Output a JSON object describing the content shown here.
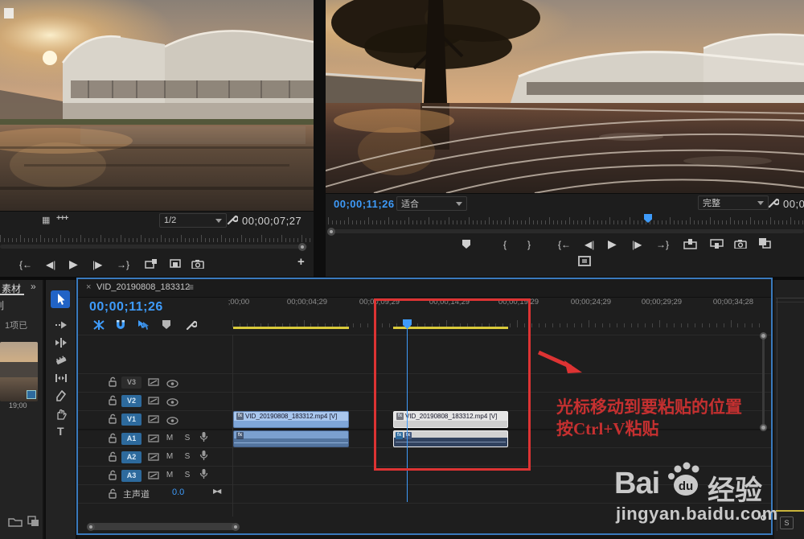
{
  "icons": {
    "close": "×",
    "menu": "≡",
    "chevron_right": "»",
    "play": "▶",
    "step_back": "◀|",
    "step_fwd": "|▶",
    "goto_in": "{←",
    "goto_out": "→}",
    "mark_in": "{",
    "mark_out": "}",
    "plus": "+",
    "safe_margins": "▦",
    "button_editor": "+++",
    "bowtie": "▶◀",
    "type_tool": "T"
  },
  "source_monitor": {
    "zoom_value": "1/2",
    "duration": "00;00;07;27"
  },
  "program_monitor": {
    "current_time": "00;00;11;26",
    "fit_value": "适合",
    "quality_value": "完整",
    "partial_time": "00;0"
  },
  "timeline": {
    "tab_title": "VID_20190808_183312",
    "current_time": "00;00;11;26",
    "ruler_labels": [
      ";00;00",
      "00;00;04;29",
      "00;00;09;29",
      "00;00;14;29",
      "00;00;19;29",
      "00;00;24;29",
      "00;00;29;29",
      "00;00;34;28"
    ],
    "video_tracks": [
      "V3",
      "V2",
      "V1"
    ],
    "audio_tracks": [
      "A1",
      "A2",
      "A3"
    ],
    "mute": "M",
    "solo": "S",
    "master_label": "主声道",
    "master_level": "0.0",
    "clip_label": "VID_20190808_183312.mp4 [V]",
    "fx": "fx"
  },
  "project_panel": {
    "tab": "素材",
    "item_fragment": "列",
    "count_fragment": "1项已",
    "thumb_duration": "19;00"
  },
  "right_panel": {
    "solo": "S"
  },
  "annotation": {
    "line1": "光标移动到要粘贴的位置",
    "line2": "按Ctrl+V粘贴"
  },
  "watermark": {
    "bai": "Bai",
    "du": "du",
    "brand_cn": "经验",
    "url": "jingyan.baidu.com"
  }
}
